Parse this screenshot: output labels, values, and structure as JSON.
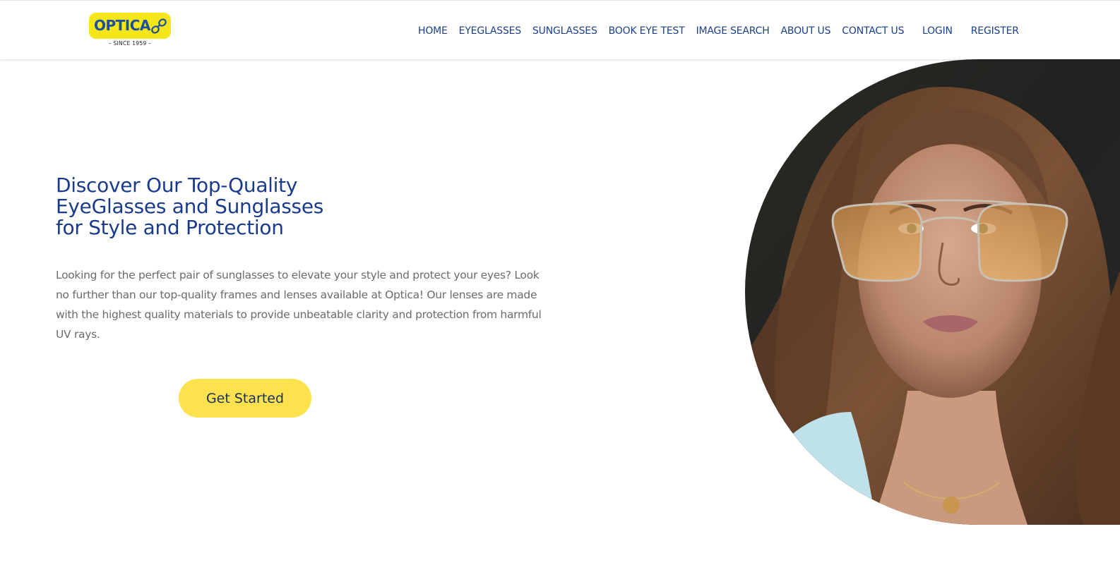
{
  "brand": {
    "logo_text": "OPTICA",
    "tagline": "– SINCE 1959 –",
    "colors": {
      "logo_yellow": "#f5e61a",
      "logo_blue": "#1d4f9c",
      "nav_blue": "#1b3f8b",
      "heading_blue": "#1a3b8c",
      "cta_yellow": "#fde24d"
    }
  },
  "nav": {
    "items": [
      {
        "label": "HOME"
      },
      {
        "label": "EYEGLASSES"
      },
      {
        "label": "SUNGLASSES"
      },
      {
        "label": "BOOK EYE TEST"
      },
      {
        "label": "IMAGE SEARCH"
      },
      {
        "label": "ABOUT US"
      },
      {
        "label": "CONTACT US"
      }
    ],
    "login_label": "LOGIN",
    "register_label": "REGISTER"
  },
  "hero": {
    "title_lines": [
      "Discover Our Top-Quality",
      "EyeGlasses and Sunglasses",
      "for Style and Protection"
    ],
    "description": "Looking for the perfect pair of sunglasses to elevate your style and protect your eyes? Look no further than our top-quality frames and lenses available at Optica! Our lenses are made with the highest quality materials to provide unbeatable clarity and protection from harmful UV rays.",
    "cta_label": "Get Started",
    "image_subject": "woman-wearing-amber-tinted-aviator-glasses"
  }
}
